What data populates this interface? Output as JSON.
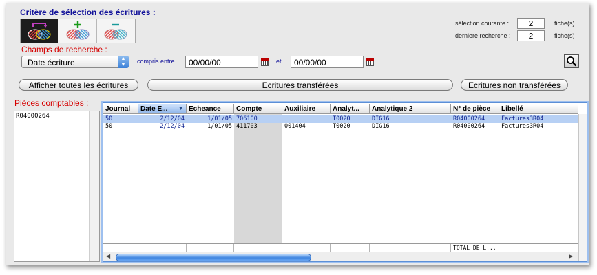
{
  "criteria": {
    "title": "Critère de sélection des écritures :",
    "tools": [
      {
        "icon": "intersect-selection-icon"
      },
      {
        "icon": "add-selection-icon"
      },
      {
        "icon": "remove-selection-icon"
      }
    ],
    "current_selection_label": "sélection courante :",
    "current_selection_value": "2",
    "last_search_label": "derniere recherche :",
    "last_search_value": "2",
    "unit": "fiche(s)"
  },
  "search": {
    "field_label": "Champs de recherche :",
    "field_value": "Date écriture",
    "between_label": "compris entre",
    "date_from": "00/00/00",
    "and_label": "et",
    "date_to": "00/00/00",
    "search_icon": "magnifier-icon"
  },
  "buttons": {
    "show_all": "Afficher toutes les écritures",
    "transferred": "Ecritures transférées",
    "not_transferred": "Ecritures non transférées"
  },
  "pieces": {
    "label": "Pièces comptables :",
    "items": [
      "R04000264"
    ]
  },
  "grid": {
    "columns": [
      "Journal",
      "Date E...",
      "Echeance",
      "Compte",
      "Auxiliaire",
      "Analyt...",
      "Analytique 2",
      "N° de pièce",
      "Libellé"
    ],
    "sorted_column": "Date E...",
    "rows": [
      {
        "journal": "50",
        "date": "2/12/04",
        "echeance": "1/01/05",
        "compte": "706100",
        "auxiliaire": "",
        "analyt": "T0020",
        "analytique2": "DIG16",
        "piece": "R04000264",
        "libelle": "Factures3R04"
      },
      {
        "journal": "50",
        "date": "2/12/04",
        "echeance": "1/01/05",
        "compte": "411703",
        "auxiliaire": "001404",
        "analyt": "T0020",
        "analytique2": "DIG16",
        "piece": "R04000264",
        "libelle": "Factures3R04"
      }
    ],
    "footer_total": "TOTAL DE L..."
  },
  "colors": {
    "title_blue": "#13139a",
    "label_red": "#d60000",
    "selection_row": "#b7d0f4",
    "text_blue": "#0a1f8e"
  }
}
